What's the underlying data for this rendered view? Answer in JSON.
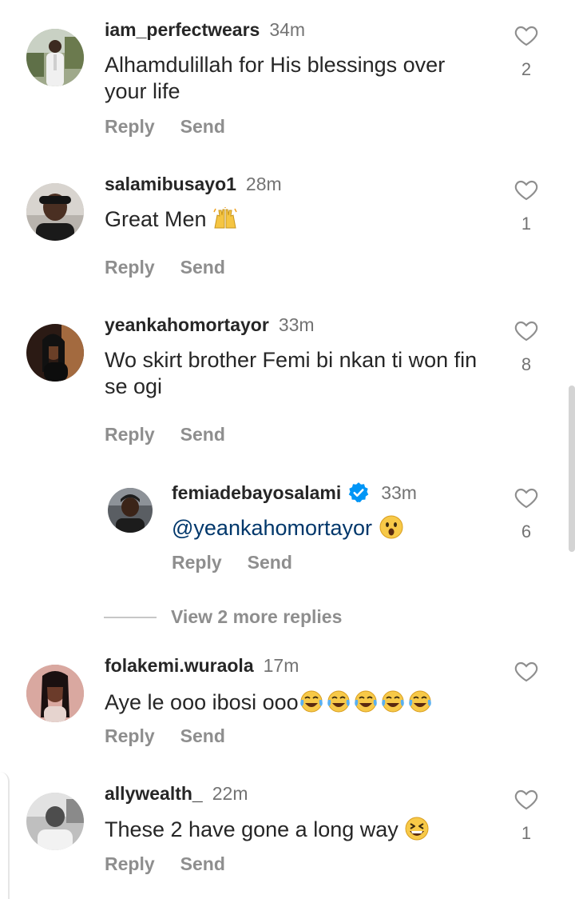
{
  "comments": [
    {
      "username": "iam_perfectwears",
      "time": "34m",
      "text": "Alhamdulillah for His blessings over your life",
      "likes": "2",
      "reply_label": "Reply",
      "send_label": "Send"
    },
    {
      "username": "salamibusayo1",
      "time": "28m",
      "text": "Great Men",
      "emoji": "raising-hands",
      "likes": "1",
      "reply_label": "Reply",
      "send_label": "Send"
    },
    {
      "username": "yeankahomortayor",
      "time": "33m",
      "text": "Wo skirt brother Femi bi nkan ti won fin se ogi",
      "likes": "8",
      "reply_label": "Reply",
      "send_label": "Send"
    },
    {
      "username": "femiadebayosalami",
      "verified": true,
      "time": "33m",
      "mention": "@yeankahomortayor",
      "emoji": "astonished-face",
      "likes": "6",
      "reply_label": "Reply",
      "send_label": "Send"
    },
    {
      "username": "folakemi.wuraola",
      "time": "17m",
      "text": "Aye le ooo ibosi ooo",
      "emoji": "tears-of-joy x5",
      "likes": "",
      "reply_label": "Reply",
      "send_label": "Send"
    },
    {
      "username": "allywealth_",
      "time": "22m",
      "text": "These 2 have gone a long way",
      "emoji": "grinning-squinting-face",
      "likes": "1",
      "reply_label": "Reply",
      "send_label": "Send"
    }
  ],
  "view_more_replies": "View 2 more replies",
  "colors": {
    "text": "#262626",
    "meta": "#737373",
    "action": "#8e8e8e",
    "mention": "#00376b",
    "verified": "#0095f6"
  }
}
